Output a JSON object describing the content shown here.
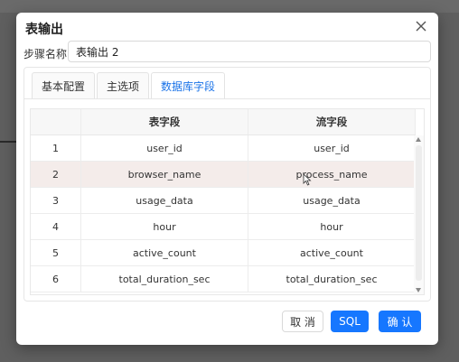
{
  "dialog": {
    "title": "表输出",
    "step_name_label": "步骤名称:",
    "step_name_value": "表输出 2"
  },
  "tabs": [
    {
      "label": "基本配置",
      "active": false
    },
    {
      "label": "主选项",
      "active": false
    },
    {
      "label": "数据库字段",
      "active": true
    }
  ],
  "table": {
    "headers": [
      "",
      "表字段",
      "流字段"
    ],
    "rows": [
      {
        "index": "1",
        "table_field": "user_id",
        "stream_field": "user_id"
      },
      {
        "index": "2",
        "table_field": "browser_name",
        "stream_field": "process_name"
      },
      {
        "index": "3",
        "table_field": "usage_data",
        "stream_field": "usage_data"
      },
      {
        "index": "4",
        "table_field": "hour",
        "stream_field": "hour"
      },
      {
        "index": "5",
        "table_field": "active_count",
        "stream_field": "active_count"
      },
      {
        "index": "6",
        "table_field": "total_duration_sec",
        "stream_field": "total_duration_sec"
      }
    ]
  },
  "buttons": {
    "cancel": "取 消",
    "sql": "SQL",
    "confirm": "确 认"
  },
  "colors": {
    "primary": "#1677ff",
    "selected_row": "#f4ecea",
    "active_tab_text": "#1a73e8"
  }
}
